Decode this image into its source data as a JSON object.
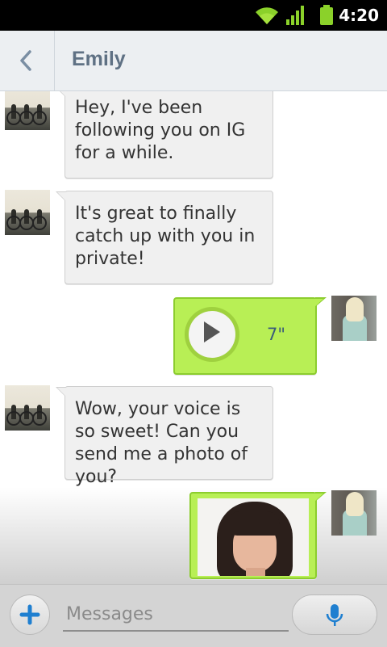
{
  "status_bar": {
    "time": "4:20",
    "wifi_icon": "wifi-icon",
    "signal_icon": "signal-icon",
    "battery_icon": "battery-icon"
  },
  "header": {
    "back_icon": "chevron-left-icon",
    "title": "Emily"
  },
  "messages": [
    {
      "sender": "Emily",
      "side": "left",
      "text": "Hey, I've been following you on IG for a while."
    },
    {
      "sender": "Emily",
      "side": "left",
      "text": "It's great to finally catch up with you in private!"
    },
    {
      "sender": "me",
      "side": "right",
      "type": "voice",
      "duration": "7\""
    },
    {
      "sender": "Emily",
      "side": "left",
      "text": "Wow, your voice is so sweet! Can you send me a photo of you?"
    },
    {
      "sender": "me",
      "side": "right",
      "type": "photo"
    }
  ],
  "composer": {
    "add_icon": "plus-icon",
    "placeholder": "Messages",
    "mic_icon": "microphone-icon"
  },
  "colors": {
    "header_title": "#5f7184",
    "sent_bubble": "#b8ef55",
    "sent_bubble_border": "#8ccd2e",
    "received_bubble": "#f0f0f0",
    "accent_blue": "#1f7fd0"
  }
}
